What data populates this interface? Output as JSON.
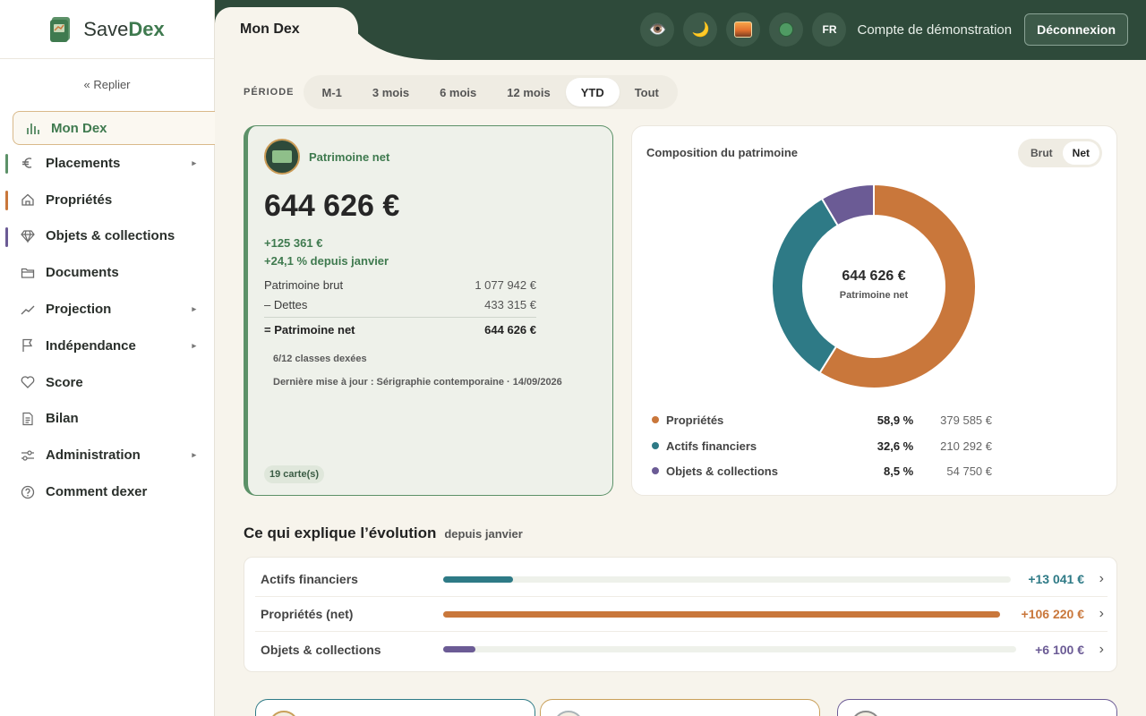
{
  "brand": {
    "name_prefix": "Save",
    "name_suffix": "Dex"
  },
  "sidebar": {
    "collapse_label": "« Replier",
    "items": [
      {
        "label": "Mon Dex",
        "icon": "bar-chart-icon",
        "active": true
      },
      {
        "label": "Placements",
        "icon": "euro-icon",
        "has_submenu": true,
        "accent": "#5c9168"
      },
      {
        "label": "Propriétés",
        "icon": "home-icon",
        "accent": "#c9773b"
      },
      {
        "label": "Objets & collections",
        "icon": "gem-icon",
        "accent": "#6b5b95"
      },
      {
        "label": "Documents",
        "icon": "folder-icon"
      },
      {
        "label": "Projection",
        "icon": "trend-icon",
        "has_submenu": true
      },
      {
        "label": "Indépendance",
        "icon": "flag-icon",
        "has_submenu": true
      },
      {
        "label": "Score",
        "icon": "heart-icon"
      },
      {
        "label": "Bilan",
        "icon": "document-icon"
      },
      {
        "label": "Administration",
        "icon": "sliders-icon",
        "has_submenu": true
      },
      {
        "label": "Comment dexer",
        "icon": "help-icon"
      }
    ]
  },
  "header": {
    "tab_title": "Mon Dex",
    "buttons": [
      "eye-icon",
      "moon-icon",
      "image-icon",
      "status-dot-icon"
    ],
    "lang": "FR",
    "account": "Compte de démonstration",
    "logout": "Déconnexion"
  },
  "period": {
    "label": "PÉRIODE",
    "options": [
      "M-1",
      "3 mois",
      "6 mois",
      "12 mois",
      "YTD",
      "Tout"
    ],
    "selected": "YTD"
  },
  "networth": {
    "title": "Patrimoine net",
    "value": "644 626 €",
    "delta_abs": "+125 361 €",
    "delta_pct": "+24,1 % depuis janvier",
    "rows": [
      {
        "label": "Patrimoine brut",
        "value": "1 077 942 €"
      },
      {
        "label": "– Dettes",
        "value": "433 315 €"
      },
      {
        "label": "= Patrimoine net",
        "value": "644 626 €"
      }
    ],
    "classes": "6/12 classes dexées",
    "last_update": "Dernière mise à jour : Sérigraphie contemporaine · 14/09/2026",
    "cards": "19 carte(s)"
  },
  "composition": {
    "title": "Composition du patrimoine",
    "toggle": [
      "Brut",
      "Net"
    ],
    "toggle_selected": "Net",
    "center_value": "644 626 €",
    "center_label": "Patrimoine net",
    "legend": [
      {
        "name": "Propriétés",
        "pct": "58,9 %",
        "amount": "379 585 €",
        "color": "#c9773b"
      },
      {
        "name": "Actifs financiers",
        "pct": "32,6 %",
        "amount": "210 292 €",
        "color": "#2e7a86"
      },
      {
        "name": "Objets & collections",
        "pct": "8,5 %",
        "amount": "54 750 €",
        "color": "#6b5b95"
      }
    ]
  },
  "chart_data": {
    "type": "pie",
    "title": "Composition du patrimoine",
    "categories": [
      "Propriétés",
      "Actifs financiers",
      "Objets & collections"
    ],
    "values": [
      58.9,
      32.6,
      8.5
    ],
    "colors": [
      "#c9773b",
      "#2e7a86",
      "#6b5b95"
    ]
  },
  "evolution": {
    "title": "Ce qui explique l’évolution",
    "subtitle": "depuis janvier",
    "rows": [
      {
        "label": "Actifs financiers",
        "value": "+13 041 €",
        "fraction": 0.123,
        "color": "#2e7a86"
      },
      {
        "label": "Propriétés (net)",
        "value": "+106 220 €",
        "fraction": 1.0,
        "color": "#c9773b"
      },
      {
        "label": "Objets & collections",
        "value": "+6 100 €",
        "fraction": 0.057,
        "color": "#6b5b95"
      }
    ]
  }
}
